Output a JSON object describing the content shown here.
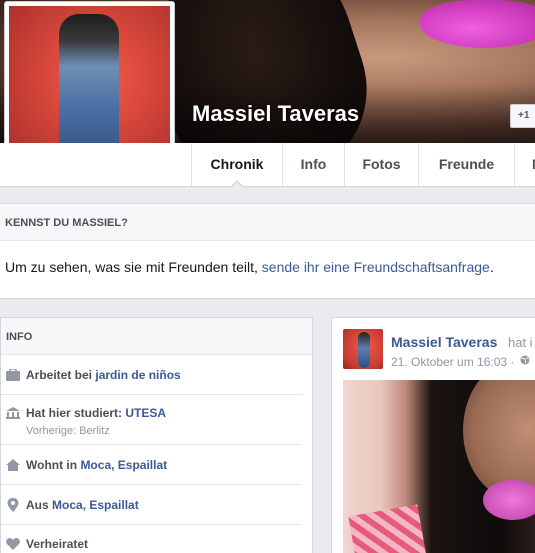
{
  "profile": {
    "name": "Massiel Taveras",
    "add_friend_label": "+1"
  },
  "nav": {
    "tabs": [
      {
        "label": "Chronik",
        "active": true
      },
      {
        "label": "Info"
      },
      {
        "label": "Fotos"
      },
      {
        "label": "Freunde"
      },
      {
        "label": "M"
      }
    ]
  },
  "know": {
    "heading": "KENNST DU MASSIEL?",
    "text_prefix": "Um zu sehen, was sie mit Freunden teilt, ",
    "link": "sende ihr eine Freundschaftsanfrage",
    "text_suffix": "."
  },
  "info": {
    "heading": "INFO",
    "items": [
      {
        "icon": "briefcase-icon",
        "prefix": "Arbeitet bei ",
        "link": "jardin de niños"
      },
      {
        "icon": "school-icon",
        "prefix": "Hat hier studiert: ",
        "link": "UTESA",
        "sub": "Vorherige: Berlitz"
      },
      {
        "icon": "home-icon",
        "prefix": "Wohnt in ",
        "link": "Moca, Espaillat"
      },
      {
        "icon": "location-pin-icon",
        "prefix": "Aus ",
        "link": "Moca, Espaillat"
      },
      {
        "icon": "heart-icon",
        "prefix": "Verheiratet",
        "link": ""
      }
    ]
  },
  "post": {
    "author": "Massiel Taveras",
    "action_fragment": "hat i",
    "timestamp": "21. Oktober um 16:03 ·",
    "privacy_icon": "globe-icon"
  },
  "colors": {
    "link": "#3b5998",
    "muted": "#9197a3",
    "page_bg": "#e9ebee"
  }
}
